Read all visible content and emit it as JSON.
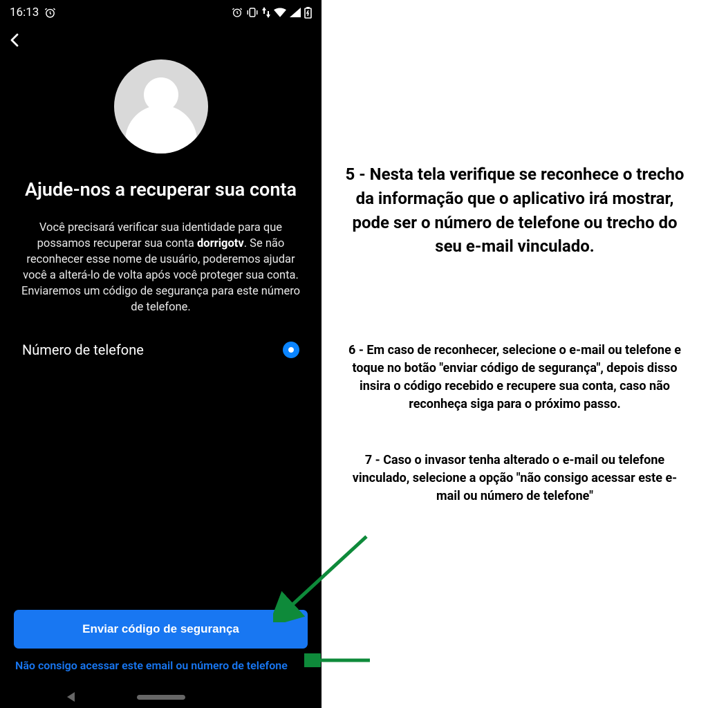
{
  "status_bar": {
    "time": "16:13"
  },
  "phone_screen": {
    "title": "Ajude-nos a recuperar sua conta",
    "description_pre": "Você precisará verificar sua identidade para que possamos recuperar sua conta ",
    "description_bold": "dorrigotv",
    "description_post": ". Se não reconhecer esse nome de usuário, poderemos ajudar você a alterá-lo de volta após você proteger sua conta. Enviaremos um código de segurança para este número de telefone.",
    "option_phone_label": "Número de telefone",
    "send_button": "Enviar código de segurança",
    "cant_access_link": "Não consigo acessar este email ou número de telefone"
  },
  "instructions": {
    "step5": "5 - Nesta tela verifique se reconhece o trecho da informação que o aplicativo irá mostrar, pode ser o número de telefone ou trecho do seu e-mail vinculado.",
    "step6": "6 - Em caso de reconhecer, selecione o e-mail ou telefone e toque no botão \"enviar código de segurança\", depois disso insira o código recebido e recupere sua conta, caso não reconheça siga para o próximo passo.",
    "step7": "7 - Caso o invasor tenha alterado o e-mail ou telefone vinculado, selecione a opção \"não consigo acessar este e-mail ou número de telefone\""
  }
}
